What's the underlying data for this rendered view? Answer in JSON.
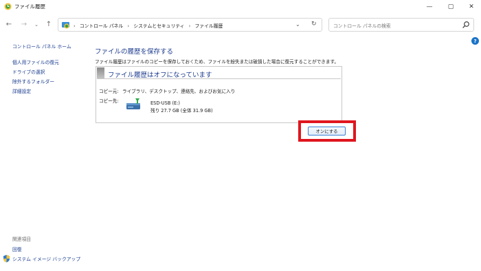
{
  "window": {
    "title": "ファイル履歴",
    "controls": {
      "minimize": "—",
      "maximize": "▢",
      "close": "✕"
    }
  },
  "nav": {
    "back": "←",
    "forward": "→",
    "history": "⌄",
    "up": "↑"
  },
  "address": {
    "separator": "›",
    "breadcrumbs": [
      "コントロール パネル",
      "システムとセキュリティ",
      "ファイル履歴"
    ],
    "dropdown": "⌄",
    "refresh": "↻"
  },
  "search": {
    "placeholder": "コントロール パネルの検索"
  },
  "sidebar": {
    "home": "コントロール パネル ホーム",
    "links": [
      "個人用ファイルの復元",
      "ドライブの選択",
      "除外するフォルダー",
      "詳細設定"
    ],
    "related_heading": "関連項目",
    "related_links": [
      "回復",
      "システム イメージ バックアップ"
    ]
  },
  "help": {
    "label": "?"
  },
  "main": {
    "heading": "ファイルの履歴を保存する",
    "description": "ファイル履歴はファイルのコピーを保存しておくため、ファイルを紛失または破損した場合に復元することができます。",
    "status": {
      "title": "ファイル履歴はオフになっています",
      "copy_from_label": "コピー元:",
      "copy_from_value": "ライブラリ、デスクトップ、連絡先、およびお気に入り",
      "copy_to_label": "コピー先:",
      "drive_name": "ESD-USB (E:)",
      "drive_space": "残り 27.7 GB (全体 31.9 GB)"
    },
    "turn_on_button": "オンにする"
  },
  "colors": {
    "link": "#1a3d8f",
    "heading": "#1e3d8f",
    "highlight": "#e0151e",
    "button_border": "#3c7fd4"
  }
}
